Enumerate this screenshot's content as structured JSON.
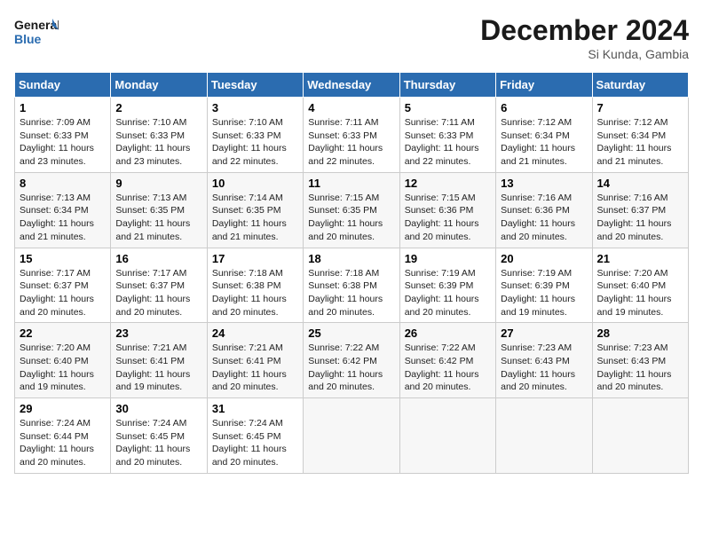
{
  "header": {
    "logo_line1": "General",
    "logo_line2": "Blue",
    "month_title": "December 2024",
    "location": "Si Kunda, Gambia"
  },
  "weekdays": [
    "Sunday",
    "Monday",
    "Tuesday",
    "Wednesday",
    "Thursday",
    "Friday",
    "Saturday"
  ],
  "weeks": [
    [
      {
        "day": "1",
        "sunrise": "7:09 AM",
        "sunset": "6:33 PM",
        "daylight": "11 hours and 23 minutes."
      },
      {
        "day": "2",
        "sunrise": "7:10 AM",
        "sunset": "6:33 PM",
        "daylight": "11 hours and 23 minutes."
      },
      {
        "day": "3",
        "sunrise": "7:10 AM",
        "sunset": "6:33 PM",
        "daylight": "11 hours and 22 minutes."
      },
      {
        "day": "4",
        "sunrise": "7:11 AM",
        "sunset": "6:33 PM",
        "daylight": "11 hours and 22 minutes."
      },
      {
        "day": "5",
        "sunrise": "7:11 AM",
        "sunset": "6:33 PM",
        "daylight": "11 hours and 22 minutes."
      },
      {
        "day": "6",
        "sunrise": "7:12 AM",
        "sunset": "6:34 PM",
        "daylight": "11 hours and 21 minutes."
      },
      {
        "day": "7",
        "sunrise": "7:12 AM",
        "sunset": "6:34 PM",
        "daylight": "11 hours and 21 minutes."
      }
    ],
    [
      {
        "day": "8",
        "sunrise": "7:13 AM",
        "sunset": "6:34 PM",
        "daylight": "11 hours and 21 minutes."
      },
      {
        "day": "9",
        "sunrise": "7:13 AM",
        "sunset": "6:35 PM",
        "daylight": "11 hours and 21 minutes."
      },
      {
        "day": "10",
        "sunrise": "7:14 AM",
        "sunset": "6:35 PM",
        "daylight": "11 hours and 21 minutes."
      },
      {
        "day": "11",
        "sunrise": "7:15 AM",
        "sunset": "6:35 PM",
        "daylight": "11 hours and 20 minutes."
      },
      {
        "day": "12",
        "sunrise": "7:15 AM",
        "sunset": "6:36 PM",
        "daylight": "11 hours and 20 minutes."
      },
      {
        "day": "13",
        "sunrise": "7:16 AM",
        "sunset": "6:36 PM",
        "daylight": "11 hours and 20 minutes."
      },
      {
        "day": "14",
        "sunrise": "7:16 AM",
        "sunset": "6:37 PM",
        "daylight": "11 hours and 20 minutes."
      }
    ],
    [
      {
        "day": "15",
        "sunrise": "7:17 AM",
        "sunset": "6:37 PM",
        "daylight": "11 hours and 20 minutes."
      },
      {
        "day": "16",
        "sunrise": "7:17 AM",
        "sunset": "6:37 PM",
        "daylight": "11 hours and 20 minutes."
      },
      {
        "day": "17",
        "sunrise": "7:18 AM",
        "sunset": "6:38 PM",
        "daylight": "11 hours and 20 minutes."
      },
      {
        "day": "18",
        "sunrise": "7:18 AM",
        "sunset": "6:38 PM",
        "daylight": "11 hours and 20 minutes."
      },
      {
        "day": "19",
        "sunrise": "7:19 AM",
        "sunset": "6:39 PM",
        "daylight": "11 hours and 20 minutes."
      },
      {
        "day": "20",
        "sunrise": "7:19 AM",
        "sunset": "6:39 PM",
        "daylight": "11 hours and 19 minutes."
      },
      {
        "day": "21",
        "sunrise": "7:20 AM",
        "sunset": "6:40 PM",
        "daylight": "11 hours and 19 minutes."
      }
    ],
    [
      {
        "day": "22",
        "sunrise": "7:20 AM",
        "sunset": "6:40 PM",
        "daylight": "11 hours and 19 minutes."
      },
      {
        "day": "23",
        "sunrise": "7:21 AM",
        "sunset": "6:41 PM",
        "daylight": "11 hours and 19 minutes."
      },
      {
        "day": "24",
        "sunrise": "7:21 AM",
        "sunset": "6:41 PM",
        "daylight": "11 hours and 20 minutes."
      },
      {
        "day": "25",
        "sunrise": "7:22 AM",
        "sunset": "6:42 PM",
        "daylight": "11 hours and 20 minutes."
      },
      {
        "day": "26",
        "sunrise": "7:22 AM",
        "sunset": "6:42 PM",
        "daylight": "11 hours and 20 minutes."
      },
      {
        "day": "27",
        "sunrise": "7:23 AM",
        "sunset": "6:43 PM",
        "daylight": "11 hours and 20 minutes."
      },
      {
        "day": "28",
        "sunrise": "7:23 AM",
        "sunset": "6:43 PM",
        "daylight": "11 hours and 20 minutes."
      }
    ],
    [
      {
        "day": "29",
        "sunrise": "7:24 AM",
        "sunset": "6:44 PM",
        "daylight": "11 hours and 20 minutes."
      },
      {
        "day": "30",
        "sunrise": "7:24 AM",
        "sunset": "6:45 PM",
        "daylight": "11 hours and 20 minutes."
      },
      {
        "day": "31",
        "sunrise": "7:24 AM",
        "sunset": "6:45 PM",
        "daylight": "11 hours and 20 minutes."
      },
      null,
      null,
      null,
      null
    ]
  ]
}
